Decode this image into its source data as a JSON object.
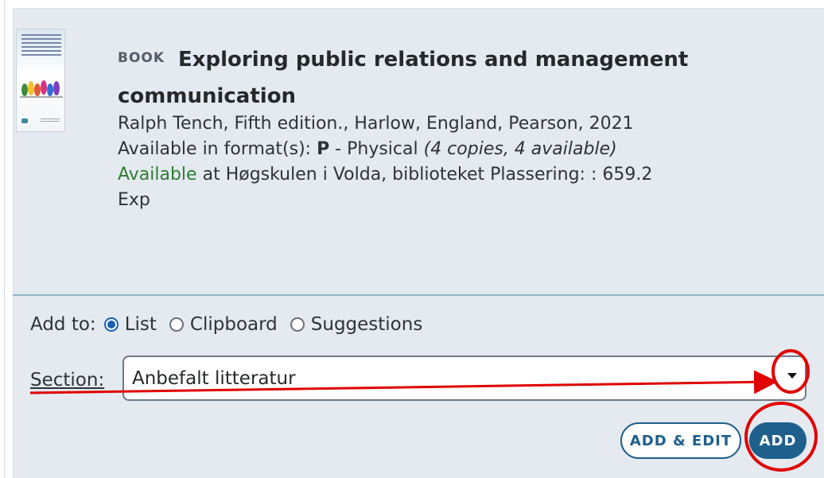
{
  "record": {
    "type": "BOOK",
    "title": "Exploring public relations and management communication",
    "author_pub": "Ralph Tench, Fifth edition., Harlow, England, Pearson, 2021",
    "format_prefix": "Available in format(s): ",
    "format_code": "P",
    "format_name": " - Physical ",
    "copies": "(4 copies, 4 available)",
    "availability_status": "Available",
    "availability_location": " at Høgskulen i Volda, biblioteket Plassering: : 659.2 Exp"
  },
  "add_to": {
    "label": "Add to:",
    "options": [
      {
        "label": "List",
        "selected": true
      },
      {
        "label": "Clipboard",
        "selected": false
      },
      {
        "label": "Suggestions",
        "selected": false
      }
    ]
  },
  "section": {
    "label": "Section:",
    "value": "Anbefalt litteratur"
  },
  "buttons": {
    "add_edit": "ADD & EDIT",
    "add": "ADD"
  },
  "colors": {
    "card_bg": "#e4eaf0",
    "accent": "#1f5f8b",
    "available": "#2e7d32",
    "annotation": "#e00000"
  },
  "icons": [
    "book-cover-thumbnail",
    "chevron-down-icon"
  ]
}
